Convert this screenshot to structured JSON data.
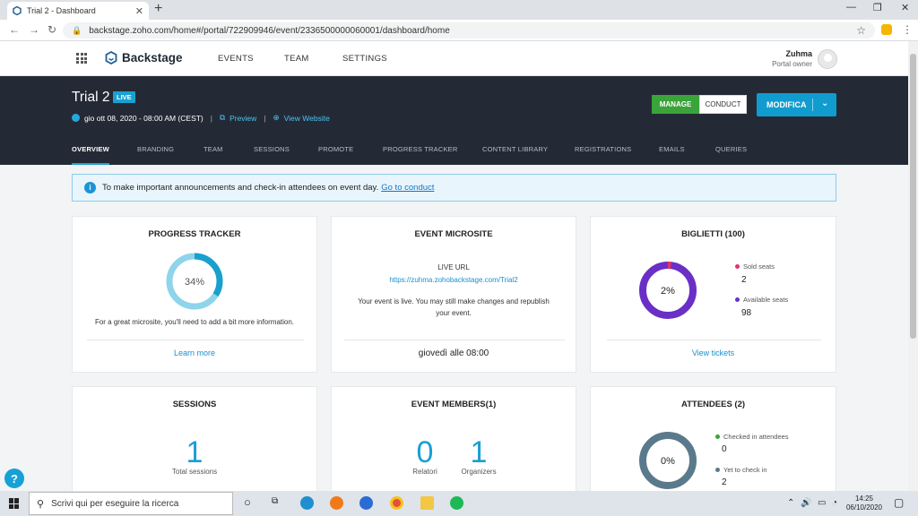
{
  "browser": {
    "tab_title": "Trial 2 - Dashboard",
    "new_tab": "+",
    "url": "backstage.zoho.com/home#/portal/722909946/event/2336500000060001/dashboard/home",
    "win_min": "—",
    "win_max": "❐",
    "win_close": "✕"
  },
  "app": {
    "logo": "Backstage",
    "nav": [
      "EVENTS",
      "TEAM",
      "SETTINGS"
    ],
    "user_name": "Zuhma",
    "user_role": "Portal owner"
  },
  "event": {
    "title": "Trial 2",
    "live": "LIVE",
    "datetime": "gio ott 08, 2020 - 08:00 AM (CEST)",
    "preview": "Preview",
    "view_website": "View Website",
    "manage": "MANAGE",
    "conduct": "CONDUCT",
    "modifica": "MODIFICA",
    "tabs": [
      "OVERVIEW",
      "BRANDING",
      "TEAM",
      "SESSIONS",
      "PROMOTE",
      "PROGRESS TRACKER",
      "CONTENT LIBRARY",
      "REGISTRATIONS",
      "EMAILS",
      "QUERIES"
    ]
  },
  "announcement": {
    "text": "To make important announcements and check-in attendees on event day.",
    "link": "Go to conduct"
  },
  "progress": {
    "title": "PROGRESS TRACKER",
    "percent": 34,
    "percent_label": "34%",
    "message": "For a great microsite, you'll need to add a bit more information.",
    "link": "Learn more"
  },
  "microsite": {
    "title": "EVENT MICROSITE",
    "live_url_label": "LIVE URL",
    "url": "https://zuhma.zohobackstage.com/Trial2",
    "message_1": "Your event is live. You may still make changes and republish",
    "message_2": "your event.",
    "footer": "giovedì alle 08:00"
  },
  "tickets": {
    "title": "BIGLIETTI (100)",
    "percent_label": "2%",
    "sold_fraction": 0.02,
    "sold_label": "Sold seats",
    "sold_value": "2",
    "available_label": "Available seats",
    "available_value": "98",
    "link": "View tickets",
    "sold_color": "#e0356a",
    "available_color": "#6a2fc6"
  },
  "sessions": {
    "title": "SESSIONS",
    "count": "1",
    "label": "Total sessions"
  },
  "members": {
    "title": "EVENT MEMBERS(1)",
    "relatori_count": "0",
    "relatori_label": "Relatori",
    "organizers_count": "1",
    "organizers_label": "Organizers"
  },
  "attendees": {
    "title": "ATTENDEES (2)",
    "percent_label": "0%",
    "checked_label": "Checked in attendees",
    "checked_value": "0",
    "yet_label": "Yet to check in",
    "yet_value": "2",
    "checked_color": "#3aa33a",
    "yet_color": "#5a7a8c"
  },
  "taskbar": {
    "search_placeholder": "Scrivi qui per eseguire la ricerca",
    "time": "14:25",
    "date": "06/10/2020"
  }
}
